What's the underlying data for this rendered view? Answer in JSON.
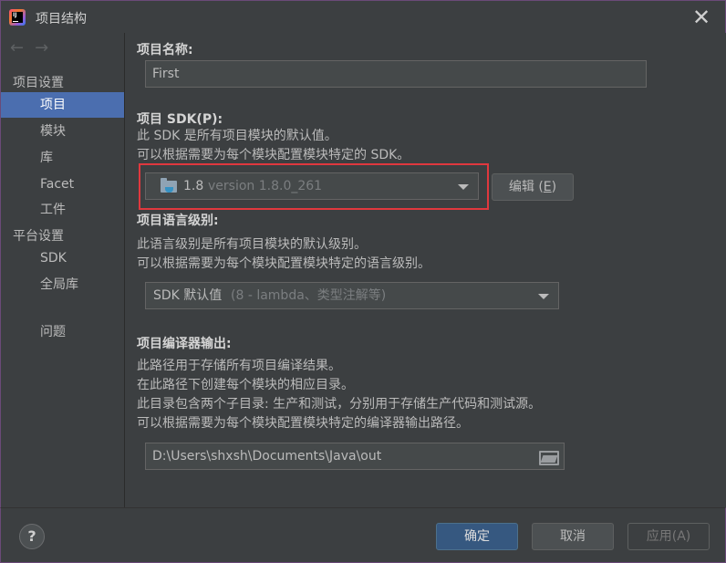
{
  "window": {
    "title": "项目结构",
    "close_glyph": "✕",
    "app_icon_text": "IJ"
  },
  "sidebar": {
    "back_glyph": "←",
    "forward_glyph": "→",
    "group_project_settings": "项目设置",
    "group_platform_settings": "平台设置",
    "items": [
      {
        "label": "项目",
        "selected": true
      },
      {
        "label": "模块"
      },
      {
        "label": "库"
      },
      {
        "label": "Facet"
      },
      {
        "label": "工件"
      },
      {
        "label": "SDK"
      },
      {
        "label": "全局库"
      },
      {
        "label": "问题"
      }
    ]
  },
  "main": {
    "project_name": {
      "title": "项目名称:",
      "value": "First"
    },
    "project_sdk": {
      "title": "项目 SDK(P):",
      "desc_line1": "此 SDK 是所有项目模块的默认值。",
      "desc_line2": "可以根据需要为每个模块配置模块特定的 SDK。",
      "selected_version": "1.8",
      "selected_detail": "version 1.8.0_261",
      "edit_button": "编辑 (E)",
      "edit_button_prefix": "编辑 (",
      "edit_button_mnemonic": "E",
      "edit_button_suffix": ")"
    },
    "language_level": {
      "title": "项目语言级别:",
      "desc_line1": "此语言级别是所有项目模块的默认级别。",
      "desc_line2": "可以根据需要为每个模块配置模块特定的语言级别。",
      "selected_main": "SDK 默认值",
      "selected_detail": "(8 - lambda、类型注解等)"
    },
    "compiler_output": {
      "title": "项目编译器输出:",
      "desc_line1": "此路径用于存储所有项目编译结果。",
      "desc_line2": "在此路径下创建每个模块的相应目录。",
      "desc_line3": "此目录包含两个子目录: 生产和测试，分别用于存储生产代码和测试源。",
      "desc_line4": "可以根据需要为每个模块配置模块特定的编译器输出路径。",
      "path": "D:\\Users\\shxsh\\Documents\\Java\\out"
    }
  },
  "footer": {
    "help": "?",
    "ok": "确定",
    "cancel": "取消",
    "apply": "应用(A)"
  },
  "colors": {
    "background": "#3c3f41",
    "selection": "#4b6eaf",
    "primary_button": "#365880",
    "highlight_border": "#e0383e"
  }
}
